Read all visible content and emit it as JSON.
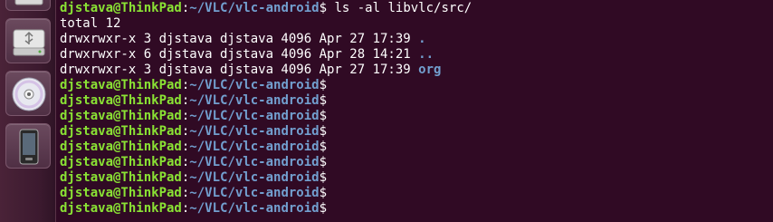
{
  "launcher": {
    "icons": [
      "drive-icon",
      "usb-drive-icon",
      "disc-icon",
      "phone-icon"
    ]
  },
  "terminal": {
    "prompt_user": "djstava@ThinkPad",
    "prompt_sep": ":",
    "prompt_path": "~/VLC/vlc-android",
    "prompt_symbol": "$",
    "command": " ls -al libvlc/src/",
    "total": "total 12",
    "entries": [
      {
        "perms": "drwxrwxr-x 3 djstava djstava 4096 Apr 27 17:39 ",
        "name": "."
      },
      {
        "perms": "drwxrwxr-x 6 djstava djstava 4096 Apr 28 14:21 ",
        "name": ".."
      },
      {
        "perms": "drwxrwxr-x 3 djstava djstava 4096 Apr 27 17:39 ",
        "name": "org"
      }
    ],
    "empty_prompt_count": 9
  },
  "colors": {
    "background": "#300a24",
    "user": "#8ae234",
    "path": "#729fcf",
    "text": "#ffffff"
  }
}
